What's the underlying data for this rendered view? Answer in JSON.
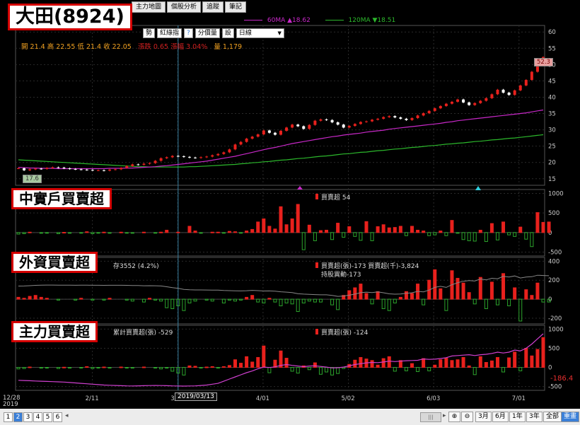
{
  "tabs": [
    "主力地圖",
    "個股分析",
    "追蹤",
    "筆記"
  ],
  "callouts": {
    "main": "大田(8924)",
    "p2": "中實戶買賣超",
    "p3": "外資買賣超",
    "p4": "主力買賣超"
  },
  "toolbar": {
    "b1": "勢",
    "b2": "紅綠指",
    "b3": "?",
    "b4": "分價量",
    "b5": "設",
    "period": "日線"
  },
  "ohlc": {
    "text": "開 21.4  高 22.55  低 21.4  收 22.05",
    "chg": "漲跌 0.65  漲幅 3.04%",
    "vol": "量 1,179"
  },
  "ma": {
    "ma60": "60MA ▲18.62",
    "ma120": "120MA ▼18.51"
  },
  "panel_labels": {
    "p2": "買賣超 54",
    "p3a": "存3552 (4.2%)",
    "p3b": "買賣超(張)-173 買賣超(千)-3,824",
    "p3c": "持股異動-173",
    "p4a": "累計買賣超(張) -529",
    "p4b": "買賣超(張) -124"
  },
  "price_badges": {
    "high": "52.3",
    "low": "17.6",
    "last_p4": "-186.4"
  },
  "dates": {
    "cursor": "2019/03/13",
    "left_a": "12/28",
    "left_b": "2019"
  },
  "pages": [
    "1",
    "2",
    "3",
    "4",
    "5",
    "6"
  ],
  "ranges": [
    "3月",
    "6月",
    "1年",
    "3年",
    "全部",
    "重畫"
  ],
  "colors": {
    "up": "#e8211d",
    "down": "#2ca52c",
    "ma60": "#c828c8",
    "ma120": "#2cb82c",
    "cum": "#d040d0"
  },
  "chart_data": [
    {
      "type": "candlestick",
      "title": "大田(8924)",
      "x_ticks": [
        "2/11",
        "3/04",
        "4/01",
        "5/02",
        "6/03",
        "7/01"
      ],
      "y_ticks": [
        15,
        20,
        25,
        30,
        35,
        40,
        45,
        50,
        55,
        60
      ],
      "ylim": [
        13,
        62
      ],
      "close": [
        18.2,
        17.6,
        17.9,
        18.1,
        18.0,
        18.3,
        18.5,
        18.4,
        18.2,
        18.0,
        17.9,
        17.8,
        17.7,
        17.6,
        17.6,
        17.5,
        17.8,
        17.9,
        18.3,
        18.9,
        19.4,
        19.3,
        19.6,
        19.8,
        20.5,
        21.3,
        21.6,
        22.0,
        21.9,
        21.7,
        21.5,
        21.4,
        21.6,
        21.8,
        22.2,
        22.6,
        23.1,
        24.0,
        25.5,
        26.3,
        27.3,
        27.9,
        28.6,
        29.8,
        29.1,
        28.5,
        29.7,
        30.7,
        31.6,
        31.1,
        30.3,
        31.5,
        32.8,
        33.2,
        33.0,
        32.3,
        31.6,
        30.7,
        31.2,
        31.8,
        32.4,
        32.6,
        33.1,
        33.4,
        33.9,
        34.2,
        33.8,
        33.4,
        33.0,
        33.6,
        34.4,
        35.1,
        35.8,
        36.6,
        37.3,
        38.0,
        38.6,
        39.3,
        38.4,
        37.6,
        38.2,
        38.9,
        39.7,
        40.9,
        42.3,
        41.4,
        40.7,
        42.1,
        43.6,
        45.3,
        47.8,
        51.0,
        52.3
      ],
      "ma60": [
        18.5,
        18.4,
        18.3,
        18.3,
        18.2,
        18.2,
        18.2,
        18.1,
        18.1,
        18.1,
        18.1,
        18.1,
        18.1,
        18.1,
        18.1,
        18.1,
        18.2,
        18.2,
        18.2,
        18.3,
        18.3,
        18.4,
        18.5,
        18.6,
        18.7,
        18.9,
        19.0,
        19.2,
        19.4,
        19.6,
        19.8,
        20.0,
        20.2,
        20.4,
        20.7,
        21.0,
        21.3,
        21.6,
        21.9,
        22.3,
        22.7,
        23.1,
        23.5,
        23.9,
        24.3,
        24.6,
        25.0,
        25.4,
        25.8,
        26.1,
        26.4,
        26.7,
        27.0,
        27.3,
        27.6,
        27.9,
        28.1,
        28.4,
        28.6,
        28.8,
        29.0,
        29.3,
        29.5,
        29.7,
        29.9,
        30.2,
        30.4,
        30.6,
        30.8,
        31.0,
        31.2,
        31.4,
        31.6,
        31.8,
        32.0,
        32.3,
        32.5,
        32.8,
        33.0,
        33.2,
        33.4,
        33.6,
        33.8,
        34.0,
        34.2,
        34.4,
        34.6,
        34.8,
        35.0,
        35.2,
        35.5,
        35.8,
        36.1
      ],
      "ma120": [
        20.8,
        20.7,
        20.6,
        20.5,
        20.4,
        20.3,
        20.2,
        20.1,
        20.0,
        19.9,
        19.8,
        19.7,
        19.6,
        19.5,
        19.4,
        19.3,
        19.2,
        19.1,
        19.0,
        18.9,
        18.8,
        18.7,
        18.7,
        18.6,
        18.6,
        18.6,
        18.6,
        18.6,
        18.6,
        18.6,
        18.7,
        18.7,
        18.8,
        18.9,
        19.0,
        19.1,
        19.2,
        19.3,
        19.4,
        19.6,
        19.7,
        19.9,
        20.0,
        20.2,
        20.3,
        20.5,
        20.7,
        20.8,
        21.0,
        21.2,
        21.3,
        21.5,
        21.7,
        21.9,
        22.0,
        22.2,
        22.4,
        22.6,
        22.7,
        22.9,
        23.1,
        23.2,
        23.4,
        23.6,
        23.7,
        23.9,
        24.1,
        24.2,
        24.4,
        24.6,
        24.7,
        24.9,
        25.1,
        25.2,
        25.4,
        25.6,
        25.7,
        25.9,
        26.0,
        26.2,
        26.4,
        26.5,
        26.7,
        26.9,
        27.0,
        27.2,
        27.4,
        27.5,
        27.7,
        27.9,
        28.1,
        28.3,
        28.5
      ]
    },
    {
      "type": "bar",
      "title": "中實戶買賣超",
      "y_ticks": [
        1000,
        500,
        0,
        -500
      ],
      "ylim": [
        -600,
        1100
      ],
      "values": [
        -40,
        -30,
        10,
        0,
        -20,
        -10,
        0,
        -30,
        5,
        -20,
        0,
        -10,
        20,
        -30,
        -10,
        10,
        -20,
        0,
        10,
        -10,
        -20,
        0,
        10,
        0,
        -10,
        10,
        60,
        0,
        10,
        0,
        160,
        40,
        -20,
        0,
        10,
        10,
        -10,
        30,
        20,
        -10,
        40,
        80,
        270,
        350,
        160,
        90,
        660,
        200,
        350,
        720,
        -440,
        190,
        -210,
        50,
        60,
        -180,
        240,
        -120,
        150,
        -100,
        -200,
        280,
        -210,
        150,
        200,
        120,
        130,
        160,
        -80,
        160,
        60,
        40,
        -80,
        -60,
        40,
        -80,
        310,
        -20,
        -180,
        -210,
        -220,
        60,
        -230,
        230,
        -190,
        270,
        -60,
        -100,
        140,
        -170,
        -360,
        510,
        260,
        270
      ]
    },
    {
      "type": "bar",
      "title": "外資買賣超",
      "y_ticks": [
        400,
        200,
        0,
        -200
      ],
      "ylim": [
        -260,
        440
      ],
      "values": [
        20,
        10,
        30,
        40,
        20,
        10,
        0,
        -10,
        0,
        0,
        -10,
        10,
        0,
        -10,
        0,
        -10,
        10,
        0,
        0,
        -10,
        -20,
        0,
        -30,
        10,
        -10,
        -20,
        -90,
        -100,
        -70,
        -120,
        -40,
        -20,
        0,
        -10,
        -20,
        0,
        -40,
        -10,
        -20,
        -10,
        20,
        40,
        -30,
        -40,
        10,
        -30,
        -70,
        -40,
        -50,
        -130,
        -40,
        -20,
        -30,
        -30,
        0,
        -60,
        -110,
        40,
        90,
        120,
        160,
        60,
        -50,
        80,
        -100,
        -120,
        -40,
        20,
        80,
        60,
        160,
        -60,
        200,
        310,
        110,
        -120,
        300,
        220,
        170,
        70,
        -50,
        230,
        -100,
        180,
        -60,
        270,
        -70,
        120,
        -230,
        100,
        40,
        170,
        -30,
        -30
      ]
    },
    {
      "type": "bar",
      "title": "主力買賣超",
      "y_ticks": [
        1000,
        500,
        0,
        -500
      ],
      "ylim": [
        -600,
        1100
      ],
      "values": [
        -40,
        -30,
        10,
        0,
        -20,
        -10,
        0,
        -30,
        5,
        -20,
        0,
        -10,
        20,
        -30,
        -10,
        10,
        -20,
        0,
        10,
        -10,
        -20,
        0,
        10,
        0,
        -10,
        -40,
        -20,
        -100,
        -150,
        -200,
        40,
        30,
        -20,
        10,
        20,
        -20,
        20,
        50,
        200,
        110,
        280,
        140,
        260,
        560,
        -140,
        190,
        430,
        240,
        -100,
        -150,
        40,
        -60,
        120,
        -180,
        -120,
        -200,
        -160,
        -30,
        80,
        190,
        260,
        220,
        180,
        60,
        230,
        280,
        -100,
        180,
        -90,
        100,
        -110,
        230,
        -90,
        60,
        200,
        240,
        180,
        200,
        260,
        40,
        -190,
        280,
        130,
        170,
        260,
        -120,
        250,
        400,
        -90,
        500,
        300,
        470,
        780
      ],
      "cumulative": [
        -330,
        -335,
        -340,
        -345,
        -350,
        -355,
        -360,
        -365,
        -370,
        -380,
        -390,
        -400,
        -410,
        -420,
        -430,
        -440,
        -445,
        -450,
        -455,
        -460,
        -462,
        -458,
        -455,
        -452,
        -450,
        -452,
        -455,
        -460,
        -462,
        -465,
        -462,
        -460,
        -450,
        -440,
        -420,
        -400,
        -350,
        -300,
        -250,
        -200,
        -150,
        -110,
        -60,
        -20,
        -30,
        -15,
        20,
        40,
        20,
        5,
        -10,
        5,
        10,
        -5,
        -20,
        -40,
        -35,
        -20,
        10,
        40,
        60,
        80,
        90,
        85,
        100,
        120,
        110,
        120,
        130,
        135,
        140,
        170,
        160,
        165,
        180,
        200,
        240,
        250,
        260,
        270,
        250,
        270,
        280,
        300,
        330,
        310,
        330,
        380,
        360,
        420,
        520,
        640,
        760
      ]
    }
  ]
}
